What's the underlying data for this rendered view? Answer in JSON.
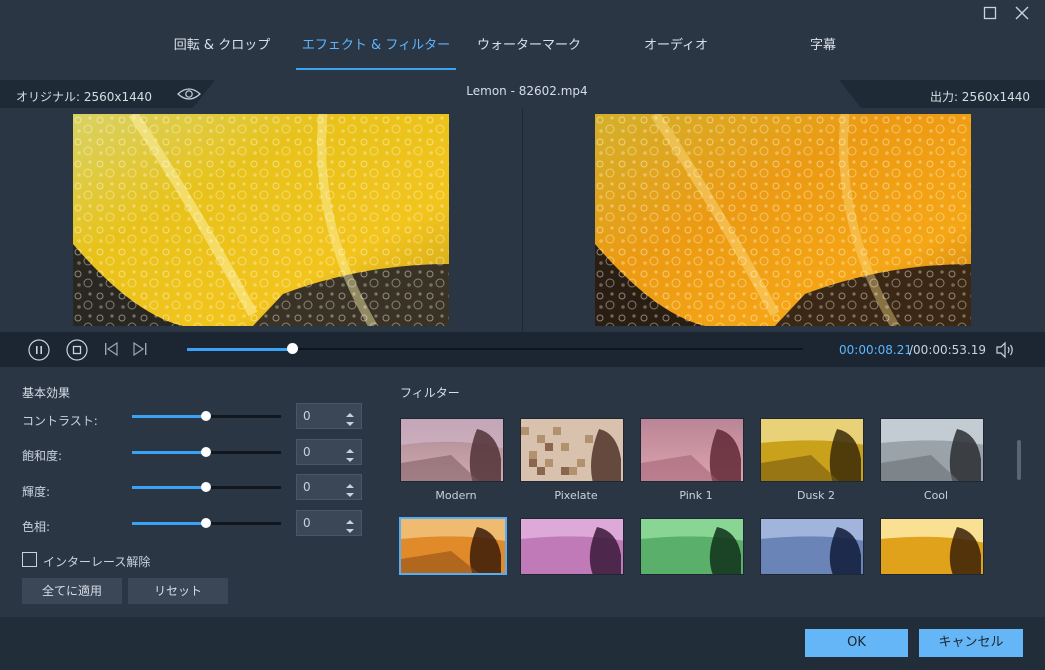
{
  "tabs": [
    {
      "label": "回転 & クロップ"
    },
    {
      "label": "エフェクト & フィルター"
    },
    {
      "label": "ウォーターマーク"
    },
    {
      "label": "オーディオ"
    },
    {
      "label": "字幕"
    }
  ],
  "preview": {
    "original_label": "オリジナル: 2560x1440",
    "filename": "Lemon - 82602.mp4",
    "output_label": "出力: 2560x1440"
  },
  "playback": {
    "current_time": "00:00:08.21",
    "total_time": "/00:00:53.19",
    "progress_fraction": 0.171
  },
  "basic": {
    "title": "基本効果",
    "contrast_label": "コントラスト:",
    "saturation_label": "飽和度:",
    "brightness_label": "輝度:",
    "hue_label": "色相:",
    "contrast_value": "0",
    "saturation_value": "0",
    "brightness_value": "0",
    "hue_value": "0",
    "deinterlace_label": "インターレース解除",
    "apply_all_label": "全てに適用",
    "reset_label": "リセット"
  },
  "filters": {
    "title": "フィルター",
    "row1": [
      {
        "name": "Modern"
      },
      {
        "name": "Pixelate"
      },
      {
        "name": "Pink 1"
      },
      {
        "name": "Dusk 2"
      },
      {
        "name": "Cool"
      }
    ]
  },
  "footer": {
    "ok_label": "OK",
    "cancel_label": "キャンセル"
  },
  "colors": {
    "accent": "#3aa3f5",
    "primary_button": "#64b6f7"
  },
  "icons": [
    "maximize-icon",
    "close-icon",
    "eye-icon",
    "pause-icon",
    "stop-icon",
    "previous-frame-icon",
    "next-frame-icon",
    "volume-icon"
  ]
}
